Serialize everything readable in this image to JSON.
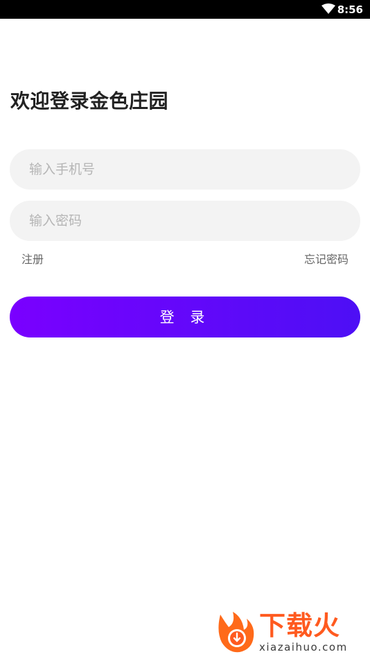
{
  "status_bar": {
    "time": "8:56",
    "wifi_icon": "wifi-icon"
  },
  "login": {
    "title": "欢迎登录金色庄园",
    "phone_placeholder": "输入手机号",
    "phone_value": "",
    "password_placeholder": "输入密码",
    "password_value": "",
    "register_label": "注册",
    "forgot_label": "忘记密码",
    "login_button_label": "登 录"
  },
  "watermark": {
    "brand_cn": "下载火",
    "brand_url": "xiazaihuo.com",
    "logo_icon": "flame-download-icon"
  },
  "colors": {
    "button_gradient_start": "#7a00ff",
    "button_gradient_end": "#4d0ff5",
    "input_background": "#f3f3f3",
    "watermark_orange": "#ff5a1f"
  }
}
